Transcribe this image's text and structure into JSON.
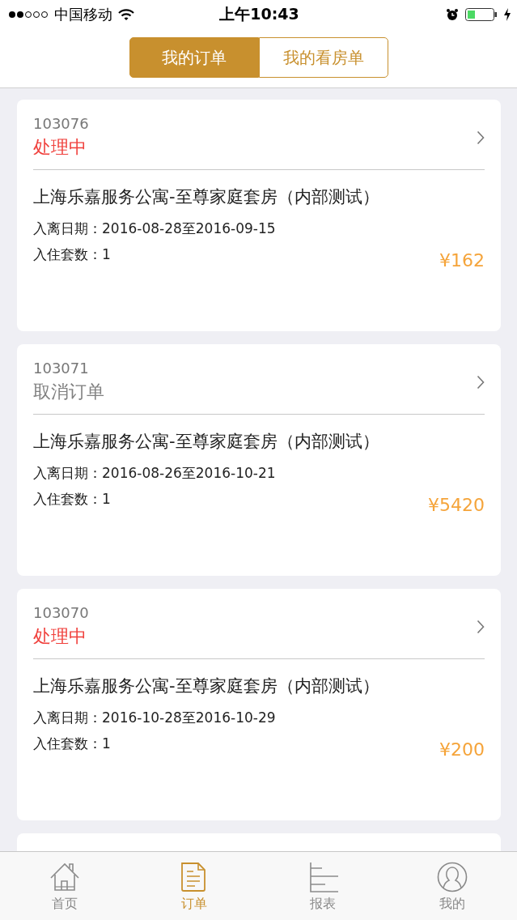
{
  "status_bar": {
    "carrier": "中国移动",
    "time": "上午10:43"
  },
  "segments": [
    {
      "label": "我的订单",
      "selected": true
    },
    {
      "label": "我的看房单",
      "selected": false
    }
  ],
  "orders": [
    {
      "number": "103076",
      "status": "处理中",
      "kind": "processing",
      "title": "上海乐嘉服务公寓-至尊家庭套房（内部测试）",
      "dates": "入离日期：2016-08-28至2016-09-15",
      "rooms": "入住套数：1",
      "price": "¥162"
    },
    {
      "number": "103071",
      "status": "取消订单",
      "kind": "cancelled",
      "title": "上海乐嘉服务公寓-至尊家庭套房（内部测试）",
      "dates": "入离日期：2016-08-26至2016-10-21",
      "rooms": "入住套数：1",
      "price": "¥5420"
    },
    {
      "number": "103070",
      "status": "处理中",
      "kind": "processing",
      "title": "上海乐嘉服务公寓-至尊家庭套房（内部测试）",
      "dates": "入离日期：2016-10-28至2016-10-29",
      "rooms": "入住套数：1",
      "price": "¥200"
    }
  ],
  "tab_bar": [
    {
      "label": "首页",
      "kind": "home",
      "selected": false
    },
    {
      "label": "订单",
      "kind": "document",
      "selected": true
    },
    {
      "label": "报表",
      "kind": "chart",
      "selected": false
    },
    {
      "label": "我的",
      "kind": "user",
      "selected": false
    }
  ]
}
